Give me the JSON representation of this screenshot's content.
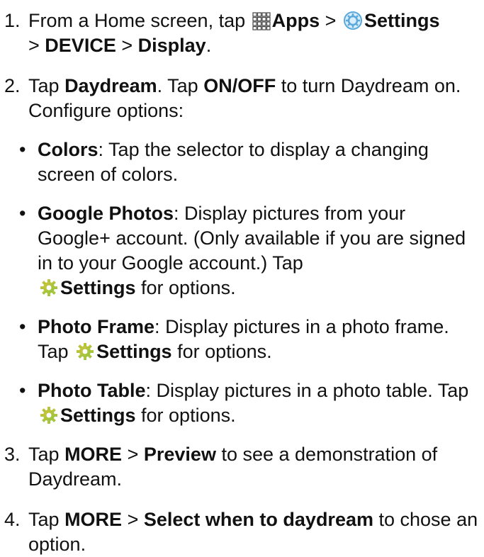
{
  "steps": [
    {
      "number": "1.",
      "text": {
        "a": "From a Home screen, tap",
        "apps": "Apps",
        "sep1": ">",
        "settings": "Settings",
        "sep2": ">",
        "device": "DEVICE",
        "sep3": ">",
        "display": "Display",
        "end": "."
      },
      "icons": {
        "apps": "apps-grid-icon",
        "settings": "settings-gear-icon"
      }
    },
    {
      "number": "2.",
      "text": {
        "a": "Tap",
        "daydream": "Daydream",
        "b": ". Tap",
        "onoff": "ON/OFF",
        "c": "to turn Daydream on. Configure options:"
      }
    },
    {
      "number": "3.",
      "text": {
        "a": "Tap",
        "more": "MORE",
        "sep": ">",
        "preview": "Preview",
        "b": "to see a demonstration of Daydream."
      }
    },
    {
      "number": "4.",
      "text": {
        "a": "Tap",
        "more": "MORE",
        "sep": ">",
        "select": "Select when to daydream",
        "b": "to chose an option."
      }
    }
  ],
  "options": [
    {
      "title": "Colors",
      "colon": ":",
      "desc": "Tap the selector to display a changing screen of colors."
    },
    {
      "title": "Google Photos",
      "colon": ":",
      "desc": "Display pictures from your Google+ account. (Only available if you are signed in to your Google account.) Tap",
      "settings": "Settings",
      "after": "for options."
    },
    {
      "title": "Photo Frame",
      "colon": ":",
      "desc": "Display pictures in a photo frame. Tap",
      "settings": "Settings",
      "after": "for options."
    },
    {
      "title": "Photo Table",
      "colon": ":",
      "desc": "Display pictures in a photo table. Tap",
      "settings": "Settings",
      "after": "for options."
    }
  ],
  "bullet_char": "•",
  "colors": {
    "text": "#111111",
    "settings_icon_blue": "#5aa8dc",
    "gear_icon_yellow": "#d4c23a",
    "gear_icon_green": "#8cc63f"
  }
}
